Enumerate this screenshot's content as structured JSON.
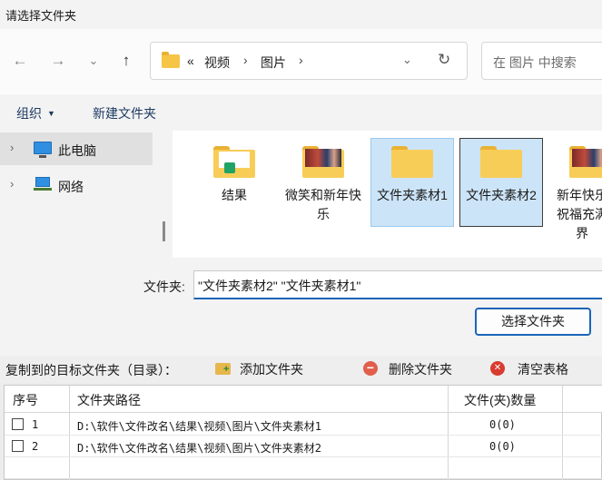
{
  "dialog": {
    "title": "请选择文件夹",
    "nav": {
      "back": "←",
      "forward": "→",
      "recent": "⌄",
      "up": "↑"
    },
    "address": {
      "prefix": "«",
      "crumbs": [
        "视频",
        "图片"
      ],
      "separator": "›",
      "dropdown": "⌄",
      "refresh": "↻"
    },
    "search": {
      "placeholder": "在 图片 中搜索"
    },
    "toolbar": {
      "organize": "组织",
      "organize_caret": "▼",
      "new_folder": "新建文件夹"
    },
    "sidebar": {
      "items": [
        {
          "label": "此电脑",
          "icon": "computer-icon",
          "chevron": "›"
        },
        {
          "label": "网络",
          "icon": "network-icon",
          "chevron": "›"
        }
      ]
    },
    "folders": [
      {
        "label": "结果",
        "icon": "folder-excel-icon",
        "selected": false
      },
      {
        "label": "微笑和新年快乐",
        "icon": "folder-photo-icon",
        "selected": false
      },
      {
        "label": "文件夹素材1",
        "icon": "folder-icon",
        "selected": true
      },
      {
        "label": "文件夹素材2",
        "icon": "folder-icon",
        "selected": true
      },
      {
        "label": "新年快乐祝福充满界",
        "icon": "folder-photo-icon",
        "selected": false
      }
    ],
    "filename": {
      "label": "文件夹:",
      "value": "\"文件夹素材2\" \"文件夹素材1\""
    },
    "select_button": "选择文件夹"
  },
  "app": {
    "title": "复制到的目标文件夹（目录）：",
    "actions": {
      "add": "添加文件夹",
      "delete": "删除文件夹",
      "clear": "清空表格"
    },
    "table": {
      "columns": [
        "序号",
        "文件夹路径",
        "文件(夹)数量"
      ],
      "rows": [
        {
          "index": "1",
          "path": "D:\\软件\\文件改名\\结果\\视频\\图片\\文件夹素材1",
          "count": "0(0)"
        },
        {
          "index": "2",
          "path": "D:\\软件\\文件改名\\结果\\视频\\图片\\文件夹素材2",
          "count": "0(0)"
        }
      ]
    }
  }
}
